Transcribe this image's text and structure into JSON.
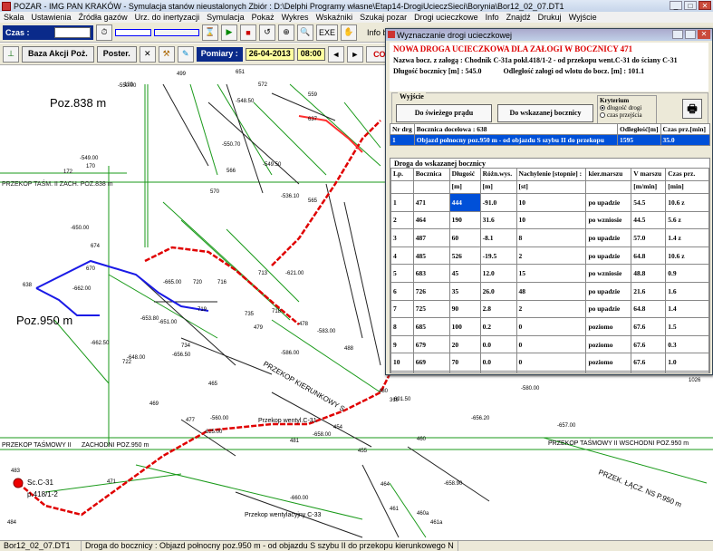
{
  "window": {
    "title": "POZAR - IMG PAN KRAKÓW - Symulacja stanów nieustalonych  Zbiór : D:\\Delphi Programy własne\\Etap14-DrogiUcieczSieci\\Borynia\\Bor12_02_07.DT1"
  },
  "menu": [
    "Skala",
    "Ustawienia",
    "Źródła gazów",
    "Urz. do inertyzacji",
    "Symulacja",
    "Pokaż",
    "Wykres",
    "Wskaźniki",
    "Szukaj pozar",
    "Drogi ucieczkowe",
    "Info",
    "Znajdź",
    "Drukuj",
    "Wyjście"
  ],
  "toolbar1": {
    "czas_label": "Czas :",
    "exe_label": "EXE",
    "info_label": "Info bocz.:"
  },
  "toolbar2": {
    "baza_label": "Baza Akcji Poż.",
    "poster_label": "Poster.",
    "pomiary_label": "Pomiary :",
    "date": "26-04-2013",
    "time": "08:00",
    "co_label": "CO",
    "m_label": "M"
  },
  "dialog": {
    "title": "Wyznaczanie drogi ucieczkowej",
    "header_line1": "NOWA DROGA UCIECZKOWA DLA ZAŁOGI W BOCZNICY    471",
    "header_line2_label": "Nazwa bocz. z załogą :",
    "header_line2_value": "Chodnik C-31a pokł.418/1-2 - od przekopu went.C-31 do ściany C-31",
    "header_line3_label": "Długość bocznicy [m] :",
    "header_line3_value": "545.0",
    "header_line3b_label": "Odległość załogi od wlotu do bocz. [m] :",
    "header_line3b_value": "101.1",
    "wyjscie_label": "Wyjście",
    "btn_fresh": "Do świeżego prądu",
    "btn_target": "Do wskazanej bocznicy",
    "kryterium_label": "Kryterium",
    "kryterium_opt1": "długość drogi",
    "kryterium_opt2": "czas przejścia",
    "table1_headers": [
      "Nr drg",
      "Bocznica docelowa : 638",
      "Odległość[m]",
      "Czas prz.[min]"
    ],
    "table1_rows": [
      [
        "1",
        "Objazd połnocny poz.950 m - od objazdu S szybu II do przekopu",
        "1595",
        "35.0"
      ]
    ],
    "table2_title": "Droga do wskazanej bocznicy",
    "table2_headers": [
      "Lp.",
      "Bocznica",
      "Długość",
      "Różn.wys.",
      "Nachylenie [stopnie] :",
      "kier.marszu",
      "V marszu",
      "Czas prz."
    ],
    "table2_units": [
      "",
      "",
      "[m]",
      "[m]",
      "[st]",
      "",
      "[m/min]",
      "[min]"
    ],
    "table2_rows": [
      [
        "1",
        "471",
        "444",
        "-91.0",
        "10",
        "po upadzie",
        "54.5",
        "10.6  z"
      ],
      [
        "2",
        "464",
        "190",
        "31.6",
        "10",
        "po wzniosie",
        "44.5",
        "5.6  z"
      ],
      [
        "3",
        "487",
        "60",
        "-8.1",
        "8",
        "po upadzie",
        "57.0",
        "1.4  z"
      ],
      [
        "4",
        "485",
        "526",
        "-19.5",
        "2",
        "po upadzie",
        "64.8",
        "10.6 z"
      ],
      [
        "5",
        "683",
        "45",
        "12.0",
        "15",
        "po wzniosie",
        "48.8",
        "0.9"
      ],
      [
        "6",
        "726",
        "35",
        "26.0",
        "48",
        "po upadzie",
        "21.6",
        "1.6"
      ],
      [
        "7",
        "725",
        "90",
        "2.8",
        "2",
        "po upadzie",
        "64.8",
        "1.4"
      ],
      [
        "8",
        "685",
        "100",
        "0.2",
        "0",
        "poziomo",
        "67.6",
        "1.5"
      ],
      [
        "9",
        "679",
        "20",
        "0.0",
        "0",
        "poziomo",
        "67.6",
        "0.3"
      ],
      [
        "10",
        "669",
        "70",
        "0.0",
        "0",
        "poziomo",
        "67.6",
        "1.0"
      ],
      [
        "11",
        "636",
        "15",
        "0.0",
        "0",
        "poziomo",
        "67.6",
        "0.2"
      ],
      [
        "12",
        "638",
        "255",
        "0.3",
        "0",
        "poziomo",
        "67.6",
        "3.8"
      ]
    ]
  },
  "map": {
    "labels": [
      "Poz.838 m",
      "Poz.950 m",
      "PRZEKOP TAŚM. II ZACH. POZ.838 m",
      "PRZEKOP TAŚMOWY II",
      "ZACHODNI POZ.950 m",
      "PRZEKOP TAŚMOWY II WSCHODNI POZ.950 m",
      "PRZEK. ŁĄCZ. NS P.950 m",
      "Przekop wentylacyjny C-33",
      "Przekop wentyl.C-31",
      "PRZEKOP KIERUNKOWY S",
      "Sc.C-31",
      "p.418/1-2",
      "Pochylnia",
      "Kornyta"
    ],
    "numbers": [
      "499",
      "139",
      "651",
      "572",
      "559",
      "637",
      "170",
      "172",
      "566",
      "570",
      "565",
      "670",
      "674",
      "638",
      "483",
      "484",
      "488",
      "480",
      "319",
      "1026",
      "464",
      "461",
      "455",
      "465",
      "469",
      "471",
      "477",
      "481",
      "460",
      "460a",
      "461a",
      "454",
      "478",
      "479",
      "713",
      "716",
      "720",
      "719",
      "735",
      "718",
      "734",
      "722",
      "667"
    ],
    "values": [
      "-550.00",
      "-549.00",
      "-650.00",
      "-621.00",
      "-625.00",
      "-658.00",
      "-657.00",
      "-560.00",
      "-601.50",
      "-580.00",
      "-656.20",
      "-658.90",
      "-660.00",
      "-662.00",
      "-548.50",
      "-550.70",
      "-549.50",
      "-536.10",
      "-583.00",
      "-665.00",
      "-586.00",
      "-662.50",
      "-653.80",
      "-648.00",
      "-656.50",
      "-651.00"
    ]
  },
  "status": {
    "file": "Bor12_02_07.DT1",
    "message": "Droga do bocznicy : Objazd połnocny poz.950 m - od objazdu S szybu II do przekopu kierunkowego N"
  },
  "colors": {
    "route": "#e00000",
    "highlight": "#0050d8",
    "blue_route": "#1a1ae6",
    "green_line": "#1a9a1a",
    "red_vent": "#ff0000"
  }
}
